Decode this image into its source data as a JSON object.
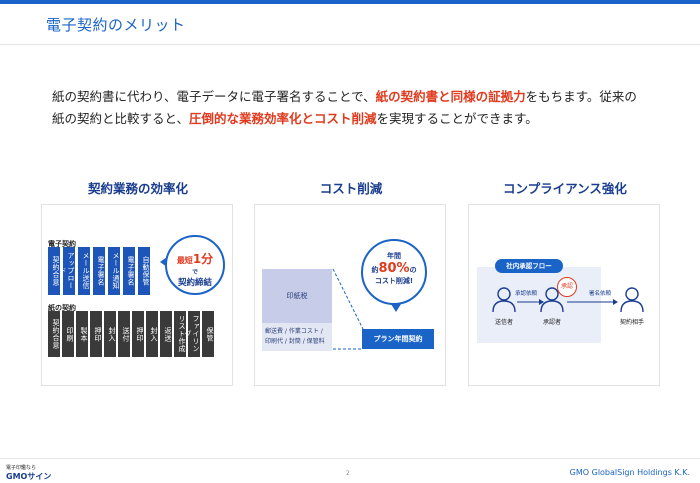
{
  "header": {
    "title": "電子契約のメリット"
  },
  "lead": {
    "p1": "紙の契約書に代わり、電子データに電子署名することで、",
    "p1_red": "紙の契約書と同様の証拠力",
    "p2": "をもちます。従来の",
    "p3": "紙の契約と比較すると、",
    "p3_red": "圧倒的な業務効率化とコスト削減",
    "p4": "を実現することができます。"
  },
  "columns": {
    "c1_title": "契約業務の効率化",
    "c2_title": "コスト削減",
    "c3_title": "コンプライアンス強化"
  },
  "card1": {
    "electronic_label": "電子契約",
    "electronic_steps": [
      "契約合意",
      "アップロード",
      "メール送信",
      "電子署名",
      "メール通知",
      "電子署名",
      "自動保管"
    ],
    "paper_label": "紙の契約",
    "paper_steps": [
      "契約合意",
      "印刷",
      "製本",
      "押印",
      "封入",
      "送付",
      "押印",
      "封入",
      "返送",
      "リスト作成",
      "ファイリング",
      "保管"
    ],
    "bubble_l1_pre": "最短",
    "bubble_l1_big": "1分",
    "bubble_l2": "で",
    "bubble_l3": "契約締結"
  },
  "card2": {
    "stamp_tax": "印紙税",
    "costs_line1": "郵送費 / 作業コスト /",
    "costs_line2": "印刷代 / 封筒 / 保管料",
    "plan": "プラン年間契約",
    "bubble_a": "年間",
    "bubble_b_pre": "約",
    "bubble_b_pct": "80%",
    "bubble_b_post": "の",
    "bubble_c": "コスト削減!"
  },
  "card3": {
    "flow_label": "社内承認フロー",
    "req1": "承認依頼",
    "req2": "署名依頼",
    "stamp": "承認",
    "sender": "送信者",
    "approver": "承認者",
    "counterparty": "契約相手"
  },
  "footer": {
    "logo_small": "電子印鑑なら",
    "logo_big": "GMOサイン",
    "page": "2",
    "company": "GMO GlobalSign Holdings K.K."
  },
  "colors": {
    "brand": "#1a63c7",
    "accent_red": "#e03a1f",
    "dark": "#3a3a3a",
    "navy": "#1a3d8f"
  }
}
